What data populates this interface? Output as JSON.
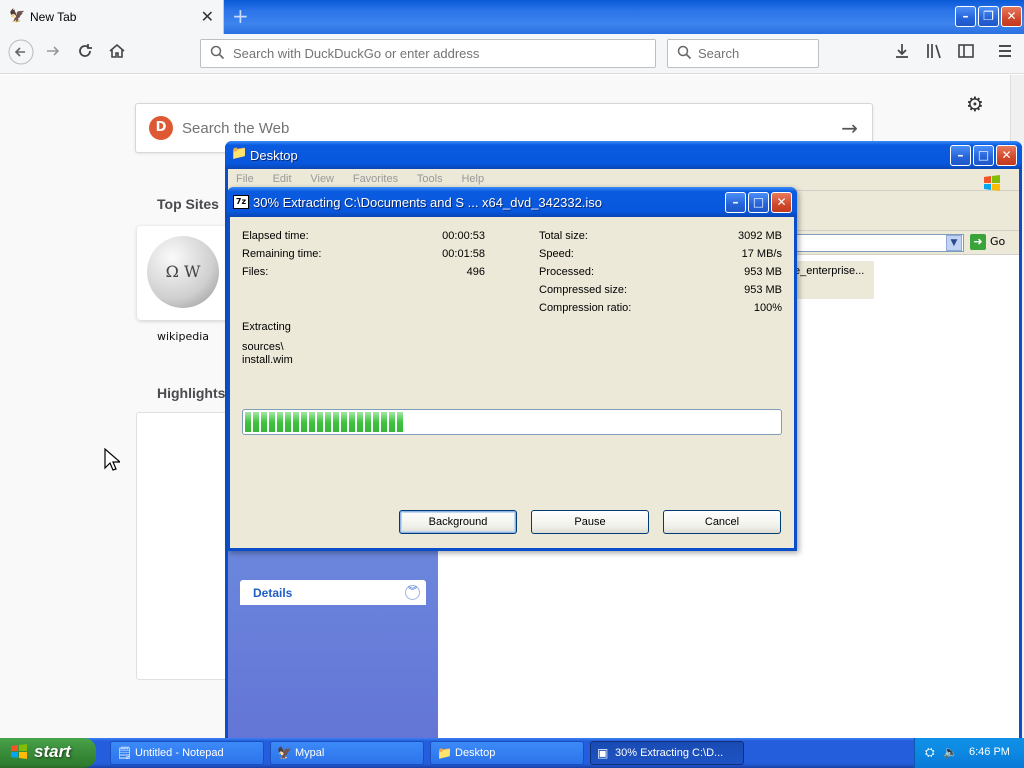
{
  "firefox": {
    "tab_title": "New Tab",
    "new_tab_symbol": "+",
    "url_placeholder": "Search with DuckDuckGo or enter address",
    "search_placeholder": "Search",
    "web_search_placeholder": "Search the Web",
    "top_sites_title": "Top Sites",
    "highlights_title": "Highlights",
    "top_sites": [
      {
        "label": "wikipedia"
      }
    ]
  },
  "explorer": {
    "title": "Desktop",
    "menu": [
      "File",
      "Edit",
      "View",
      "Favorites",
      "Tools",
      "Help"
    ],
    "go_label": "Go",
    "details_label": "Details",
    "file_item_label": "e_enterprise..."
  },
  "zip_dialog": {
    "title": "30% Extracting C:\\Documents and S ... x64_dvd_342332.iso",
    "progress_percent": 30,
    "left_stats": [
      {
        "label": "Elapsed time:",
        "value": "00:00:53"
      },
      {
        "label": "Remaining time:",
        "value": "00:01:58"
      },
      {
        "label": "Files:",
        "value": "496"
      }
    ],
    "right_stats": [
      {
        "label": "Total size:",
        "value": "3092 MB"
      },
      {
        "label": "Speed:",
        "value": "17 MB/s"
      },
      {
        "label": "Processed:",
        "value": "953 MB"
      },
      {
        "label": "Compressed size:",
        "value": "953 MB"
      },
      {
        "label": "Compression ratio:",
        "value": "100%"
      }
    ],
    "action_label": "Extracting",
    "current_path": "sources\\",
    "current_file": "install.wim",
    "buttons": {
      "background": "Background",
      "pause": "Pause",
      "cancel": "Cancel"
    }
  },
  "taskbar": {
    "start_label": "start",
    "tasks": [
      {
        "label": "Untitled - Notepad"
      },
      {
        "label": "Mypal"
      },
      {
        "label": "Desktop"
      },
      {
        "label": "30% Extracting C:\\D..."
      }
    ],
    "clock": "6:46 PM"
  },
  "colors": {
    "xp_blue": "#0a5be0",
    "progress_green": "#3fc43f",
    "start_green": "#3c8f3c"
  }
}
